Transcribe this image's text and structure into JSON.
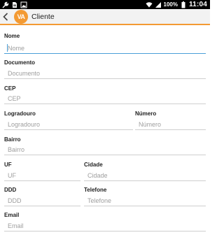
{
  "status_bar": {
    "battery": "100%",
    "time": "11:04",
    "icons": [
      "wrench-icon",
      "document-icon",
      "image-icon",
      "wifi-icon",
      "signal-icon",
      "battery-icon"
    ]
  },
  "app_bar": {
    "logo": "VA",
    "title": "Cliente"
  },
  "form": {
    "nome": {
      "label": "Nome",
      "placeholder": "Nome"
    },
    "documento": {
      "label": "Documento",
      "placeholder": "Documento"
    },
    "cep": {
      "label": "CEP",
      "placeholder": "CEP"
    },
    "logradouro": {
      "label": "Logradouro",
      "placeholder": "Logradouro"
    },
    "numero": {
      "label": "Número",
      "placeholder": "Número"
    },
    "bairro": {
      "label": "Bairro",
      "placeholder": "Bairro"
    },
    "uf": {
      "label": "UF",
      "placeholder": "UF"
    },
    "cidade": {
      "label": "Cidade",
      "placeholder": "Cidade"
    },
    "ddd": {
      "label": "DDD",
      "placeholder": "DDD"
    },
    "telefone": {
      "label": "Telefone",
      "placeholder": "Telefone"
    },
    "email": {
      "label": "Email",
      "placeholder": "Email"
    }
  },
  "colors": {
    "accent": "#f39a33",
    "focus_underline": "#4a9fd8"
  }
}
